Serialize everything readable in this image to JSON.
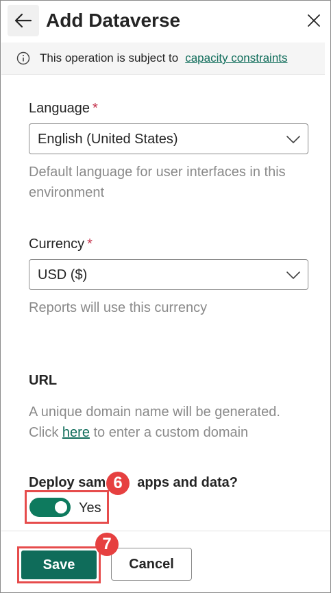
{
  "header": {
    "title": "Add Dataverse"
  },
  "banner": {
    "text": "This operation is subject to",
    "link": "capacity constraints"
  },
  "language": {
    "label": "Language",
    "required_mark": "*",
    "value": "English (United States)",
    "hint": "Default language for user interfaces in this environment"
  },
  "currency": {
    "label": "Currency",
    "required_mark": "*",
    "value": "USD ($)",
    "hint": "Reports will use this currency"
  },
  "url": {
    "title": "URL",
    "hint_line1": "A unique domain name will be generated.",
    "hint_prefix": "Click",
    "hint_link": "here",
    "hint_suffix": "to enter a custom domain"
  },
  "deploy": {
    "question_part1": "Deploy sam",
    "question_part2": "apps and data?",
    "toggle_label": "Yes",
    "toggle_on": true
  },
  "badges": {
    "step6": "6",
    "step7": "7"
  },
  "footer": {
    "save_label": "Save",
    "cancel_label": "Cancel"
  },
  "colors": {
    "accent": "#0f6c5a",
    "toggle": "#0e7a5e",
    "badge": "#e64040",
    "highlight": "#e64c4c",
    "required": "#c4314b"
  },
  "icons": {
    "back": "arrow-left-icon",
    "close": "close-icon",
    "info": "info-icon",
    "chevron": "chevron-down-icon"
  }
}
